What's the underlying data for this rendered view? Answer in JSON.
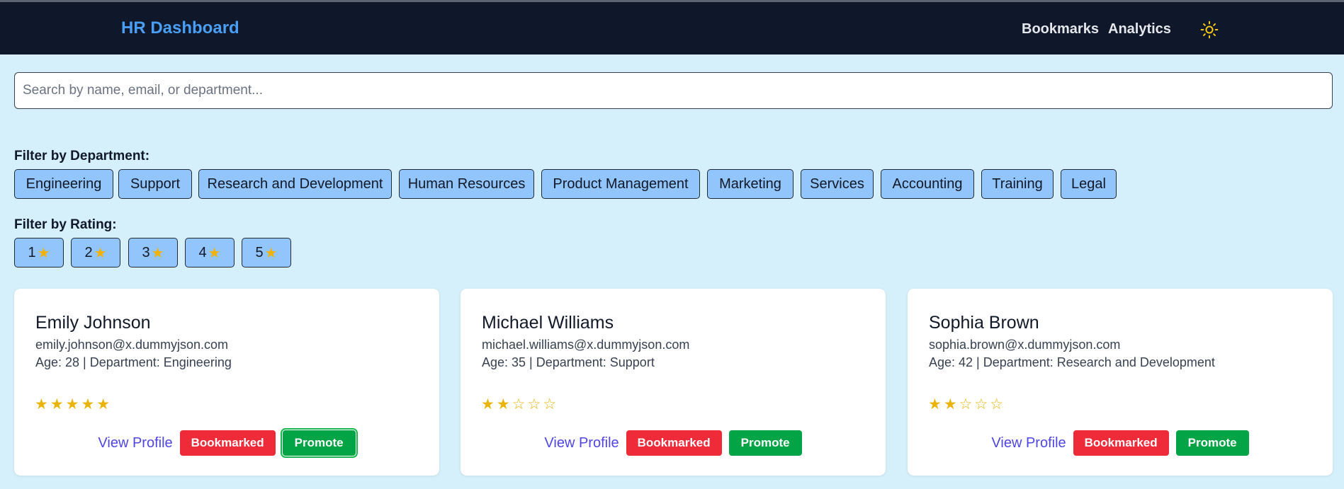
{
  "header": {
    "brand": "HR Dashboard",
    "nav": [
      "Bookmarks",
      "Analytics"
    ],
    "theme_icon": "sun-icon",
    "colors": {
      "background": "#0f172a",
      "brand": "#4a9ff5"
    }
  },
  "search": {
    "placeholder": "Search by name, email, or department...",
    "value": ""
  },
  "filters": {
    "department_label": "Filter by Department:",
    "departments": [
      "Engineering",
      "Support",
      "Research and Development",
      "Human Resources",
      "Product Management",
      "Marketing",
      "Services",
      "Accounting",
      "Training",
      "Legal"
    ],
    "rating_label": "Filter by Rating:",
    "ratings": [
      "1",
      "2",
      "3",
      "4",
      "5"
    ],
    "rating_icon": "star-icon"
  },
  "employees": [
    {
      "name": "Emily Johnson",
      "email": "emily.johnson@x.dummyjson.com",
      "meta": "Age: 28 | Department: Engineering",
      "rating": 5,
      "rating_stars": "★★★★★",
      "view_label": "View Profile",
      "bookmark_label": "Bookmarked",
      "promote_label": "Promote"
    },
    {
      "name": "Michael Williams",
      "email": "michael.williams@x.dummyjson.com",
      "meta": "Age: 35 | Department: Support",
      "rating": 2,
      "rating_stars": "★★☆☆☆",
      "view_label": "View Profile",
      "bookmark_label": "Bookmarked",
      "promote_label": "Promote"
    },
    {
      "name": "Sophia Brown",
      "email": "sophia.brown@x.dummyjson.com",
      "meta": "Age: 42 | Department: Research and Development",
      "rating": 2,
      "rating_stars": "★★☆☆☆",
      "view_label": "View Profile",
      "bookmark_label": "Bookmarked",
      "promote_label": "Promote"
    }
  ],
  "colors": {
    "page_background": "#d5f0fa",
    "chip": "#93c5fd",
    "bookmarked": "#ef2b3a",
    "promote": "#02a446",
    "link": "#4f46e5",
    "star": "#eab308"
  }
}
